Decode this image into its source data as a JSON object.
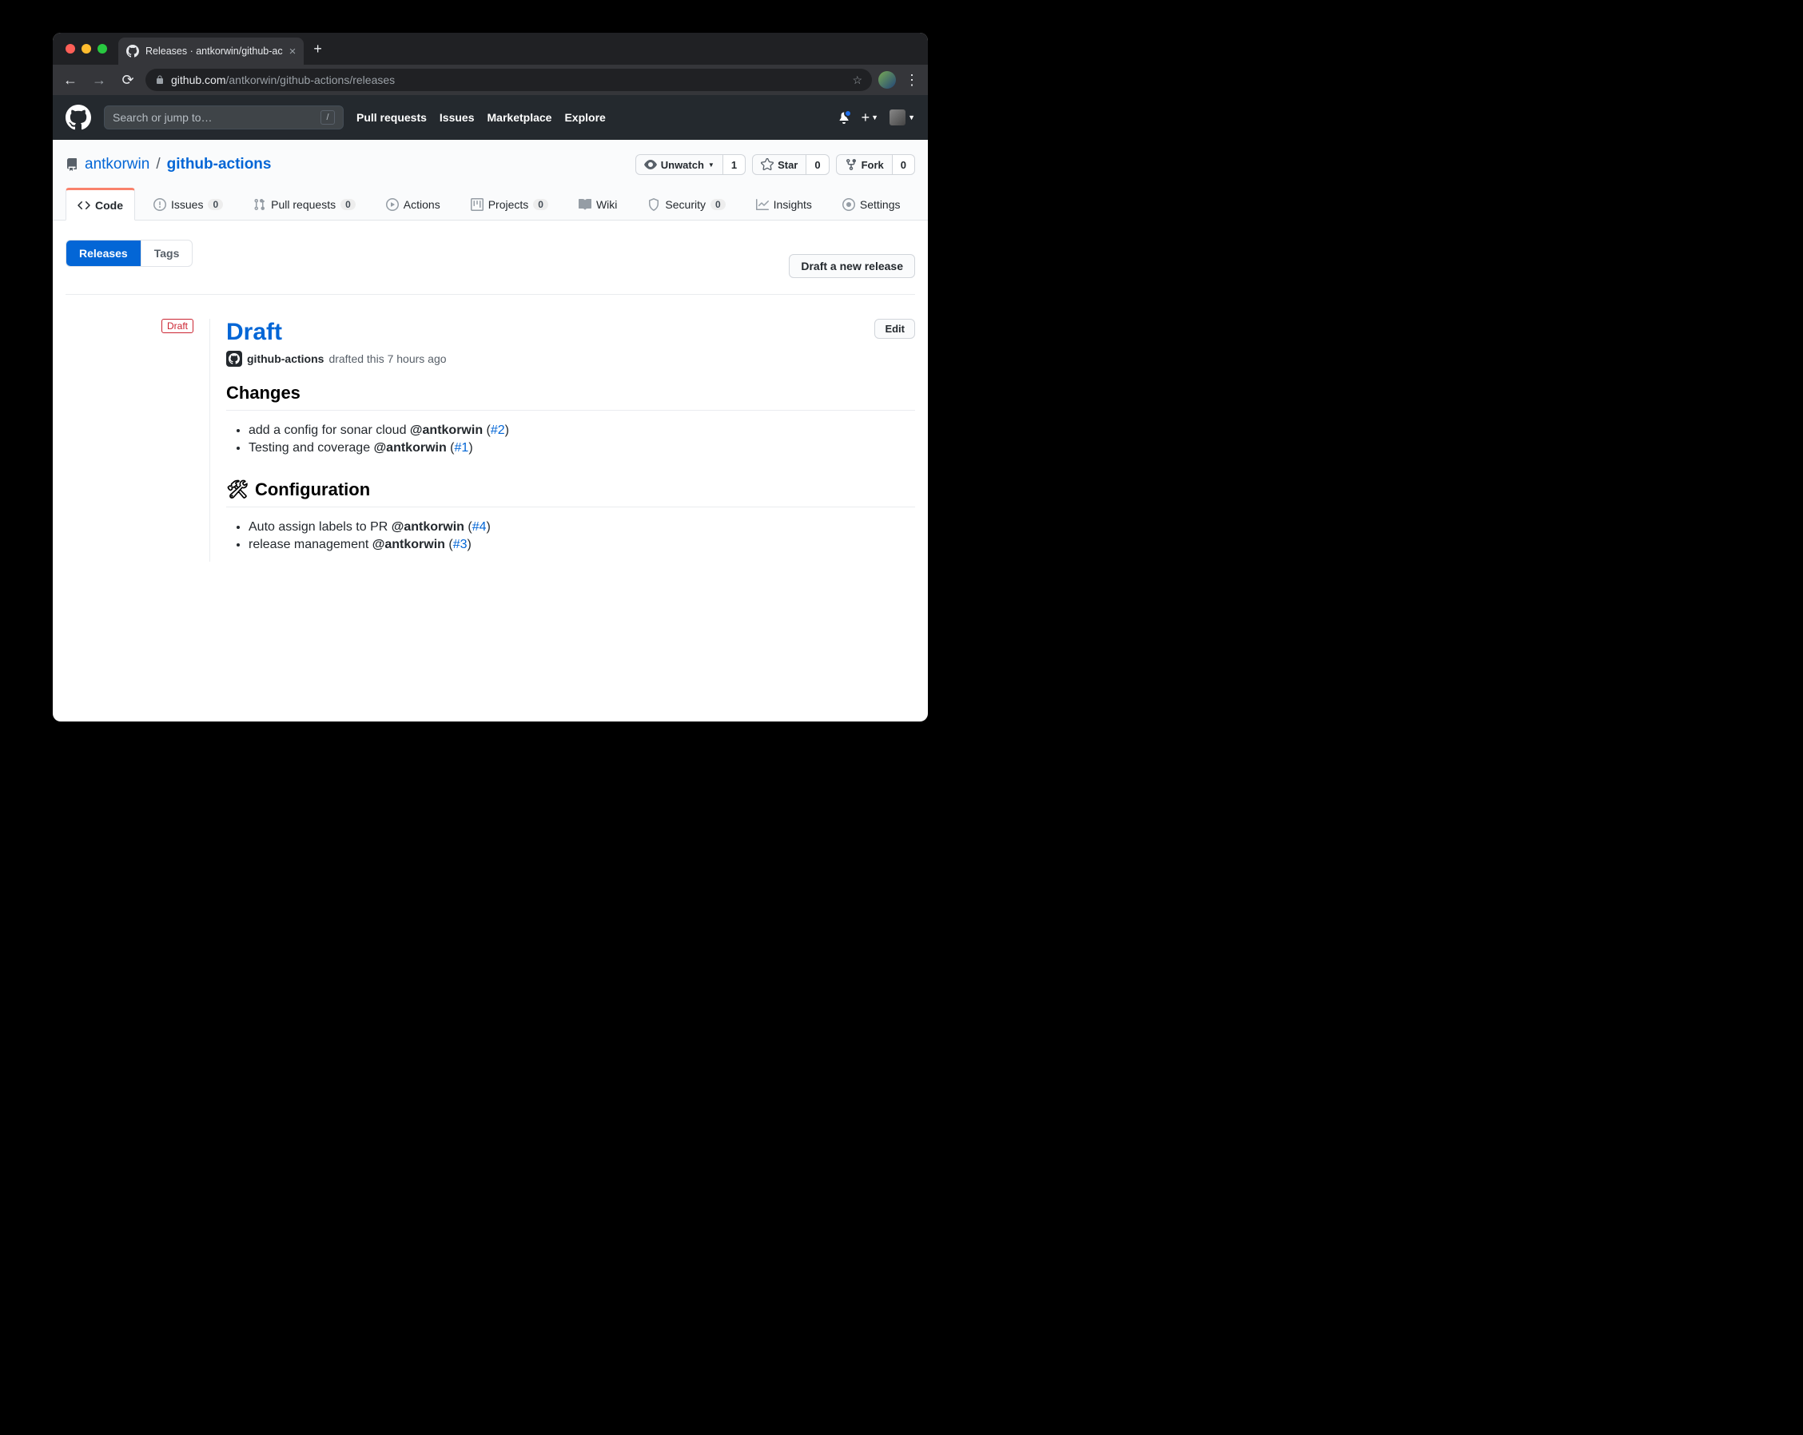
{
  "browser": {
    "tab_title": "Releases · antkorwin/github-ac",
    "url_domain": "github.com",
    "url_path": "/antkorwin/github-actions/releases"
  },
  "gh_header": {
    "search_placeholder": "Search or jump to…",
    "nav": [
      "Pull requests",
      "Issues",
      "Marketplace",
      "Explore"
    ]
  },
  "repo": {
    "owner": "antkorwin",
    "name": "github-actions",
    "actions": {
      "watch_label": "Unwatch",
      "watch_count": "1",
      "star_label": "Star",
      "star_count": "0",
      "fork_label": "Fork",
      "fork_count": "0"
    },
    "tabs": [
      {
        "label": "Code"
      },
      {
        "label": "Issues",
        "count": "0"
      },
      {
        "label": "Pull requests",
        "count": "0"
      },
      {
        "label": "Actions"
      },
      {
        "label": "Projects",
        "count": "0"
      },
      {
        "label": "Wiki"
      },
      {
        "label": "Security",
        "count": "0"
      },
      {
        "label": "Insights"
      },
      {
        "label": "Settings"
      }
    ]
  },
  "subnav": {
    "releases": "Releases",
    "tags": "Tags"
  },
  "draft_button": "Draft a new release",
  "release": {
    "badge": "Draft",
    "title": "Draft",
    "author": "github-actions",
    "meta_text": "drafted this 7 hours ago",
    "edit": "Edit",
    "sections": {
      "changes_heading": "Changes",
      "config_icon": "🛠",
      "config_heading": "Configuration"
    },
    "changes": [
      {
        "text": "add a config for sonar cloud",
        "at": "@antkorwin",
        "pr": "#2"
      },
      {
        "text": "Testing and coverage",
        "at": "@antkorwin",
        "pr": "#1"
      }
    ],
    "config": [
      {
        "text": "Auto assign labels to PR",
        "at": "@antkorwin",
        "pr": "#4"
      },
      {
        "text": "release management",
        "at": "@antkorwin",
        "pr": "#3"
      }
    ]
  }
}
